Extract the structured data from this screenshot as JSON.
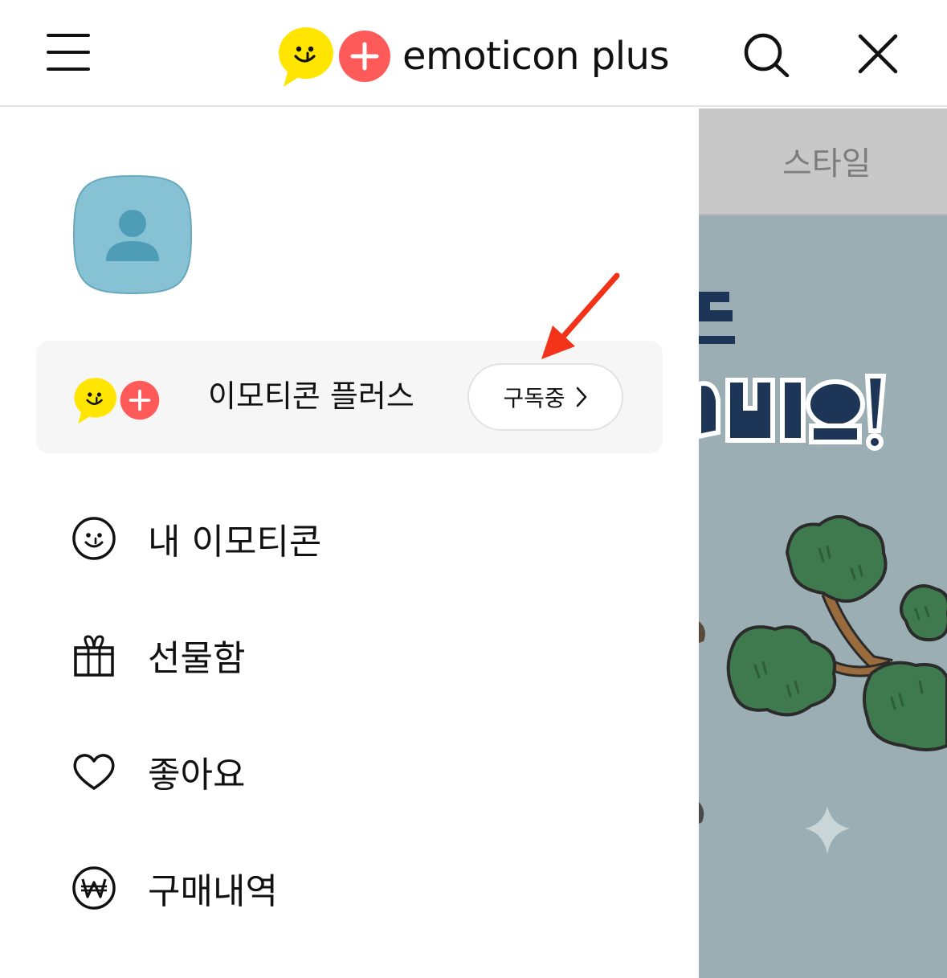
{
  "header": {
    "menu_icon": "hamburger-icon",
    "brand_text": "emoticon plus",
    "search_icon": "search-icon",
    "close_icon": "close-icon"
  },
  "drawer": {
    "avatar_icon": "person-icon",
    "plus_card": {
      "label": "이모티콘 플러스",
      "status_button": "구독중",
      "status_icon": "chevron-right-icon"
    },
    "menu": [
      {
        "label": "내 이모티콘",
        "icon": "smiley-icon"
      },
      {
        "label": "선물함",
        "icon": "gift-icon"
      },
      {
        "label": "좋아요",
        "icon": "heart-icon"
      },
      {
        "label": "구매내역",
        "icon": "won-icon"
      }
    ]
  },
  "background": {
    "tab_label": "스타일"
  },
  "colors": {
    "brand_yellow": "#FFE500",
    "brand_red": "#FF5A5A",
    "annotation_arrow": "#F2331A",
    "avatar_bg": "#86C1D4",
    "avatar_figure": "#4E9CB6",
    "card_bg": "#F6F6F6",
    "banner_bg": "#9AAEB3",
    "tabbar_bg": "#C8C8C8"
  }
}
